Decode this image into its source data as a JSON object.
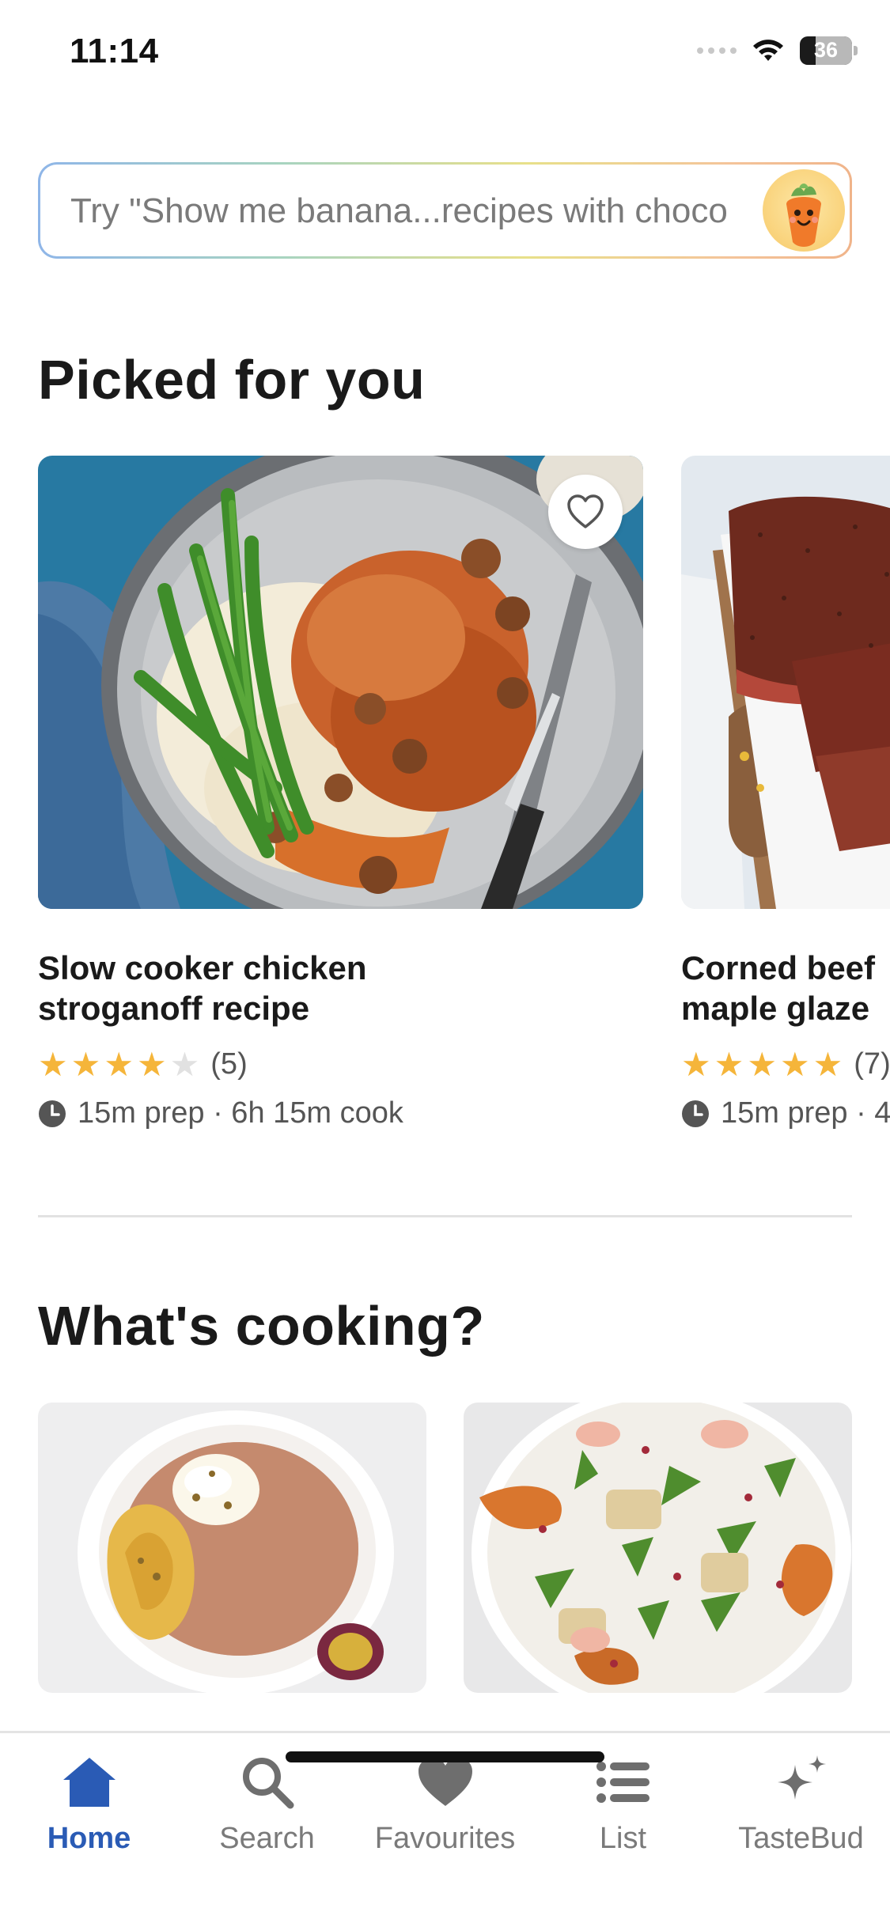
{
  "status_bar": {
    "time": "11:14",
    "battery": "36"
  },
  "search": {
    "prompt": "Try \"Show me banana...recipes with choco"
  },
  "sections": {
    "picked_title": "Picked for you",
    "cooking_title": "What's cooking?"
  },
  "picked": [
    {
      "title_line1": "Slow cooker chicken",
      "title_line2": "stroganoff recipe",
      "rating": 4,
      "rating_count": "(5)",
      "time": "15m prep · 6h 15m cook"
    },
    {
      "title_line1": "Corned beef",
      "title_line2": "maple glaze",
      "rating": 5,
      "rating_count": "(7)",
      "time": "15m prep · 4"
    }
  ],
  "nav": [
    {
      "label": "Home",
      "icon": "home-icon",
      "active": true
    },
    {
      "label": "Search",
      "icon": "search-icon",
      "active": false
    },
    {
      "label": "Favourites",
      "icon": "heart-icon",
      "active": false
    },
    {
      "label": "List",
      "icon": "list-icon",
      "active": false
    },
    {
      "label": "TasteBud",
      "icon": "sparkles-icon",
      "active": false
    }
  ],
  "colors": {
    "accent": "#2a5bb5",
    "star": "#f5b53a"
  }
}
